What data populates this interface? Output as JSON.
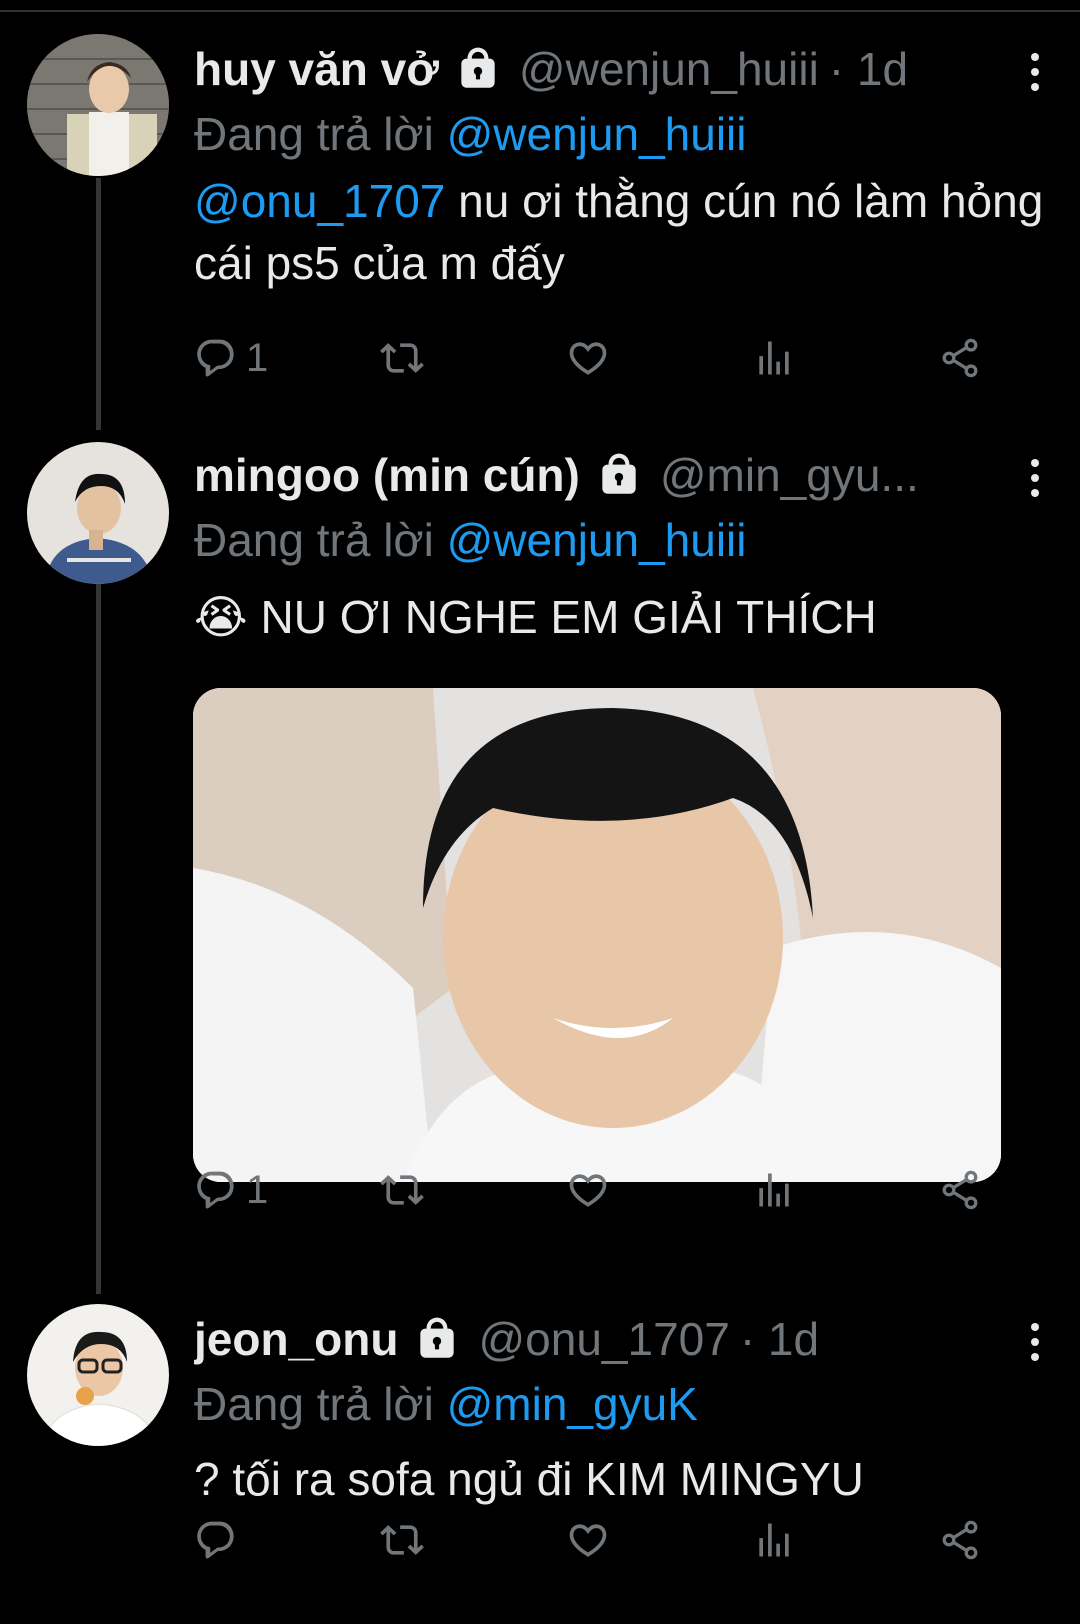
{
  "replying_to_label": "Đang trả lời",
  "tweets": [
    {
      "name": "huy văn vở",
      "handle": "@wenjun_huiii",
      "time": "· 1d",
      "replying_to": "@wenjun_huiii",
      "mention": "@onu_1707",
      "text": " nu ơi thằng cún nó làm hỏng cái ps5 của m đấy",
      "reply_count": "1"
    },
    {
      "name": "mingoo (min cún)",
      "handle": "@min_gyu...",
      "time": "",
      "replying_to": "@wenjun_huiii",
      "emoji": "😭",
      "text": " NU ƠI NGHE EM GIẢI THÍCH",
      "reply_count": "1"
    },
    {
      "name": "jeon_onu",
      "handle": "@onu_1707",
      "time": "· 1d",
      "replying_to": "@min_gyuK",
      "text": "? tối ra sofa ngủ đi KIM MINGYU",
      "reply_count": ""
    }
  ],
  "colors": {
    "background": "#000000",
    "text": "#e7e9ea",
    "muted": "#71767b",
    "accent": "#1d9bf0"
  }
}
